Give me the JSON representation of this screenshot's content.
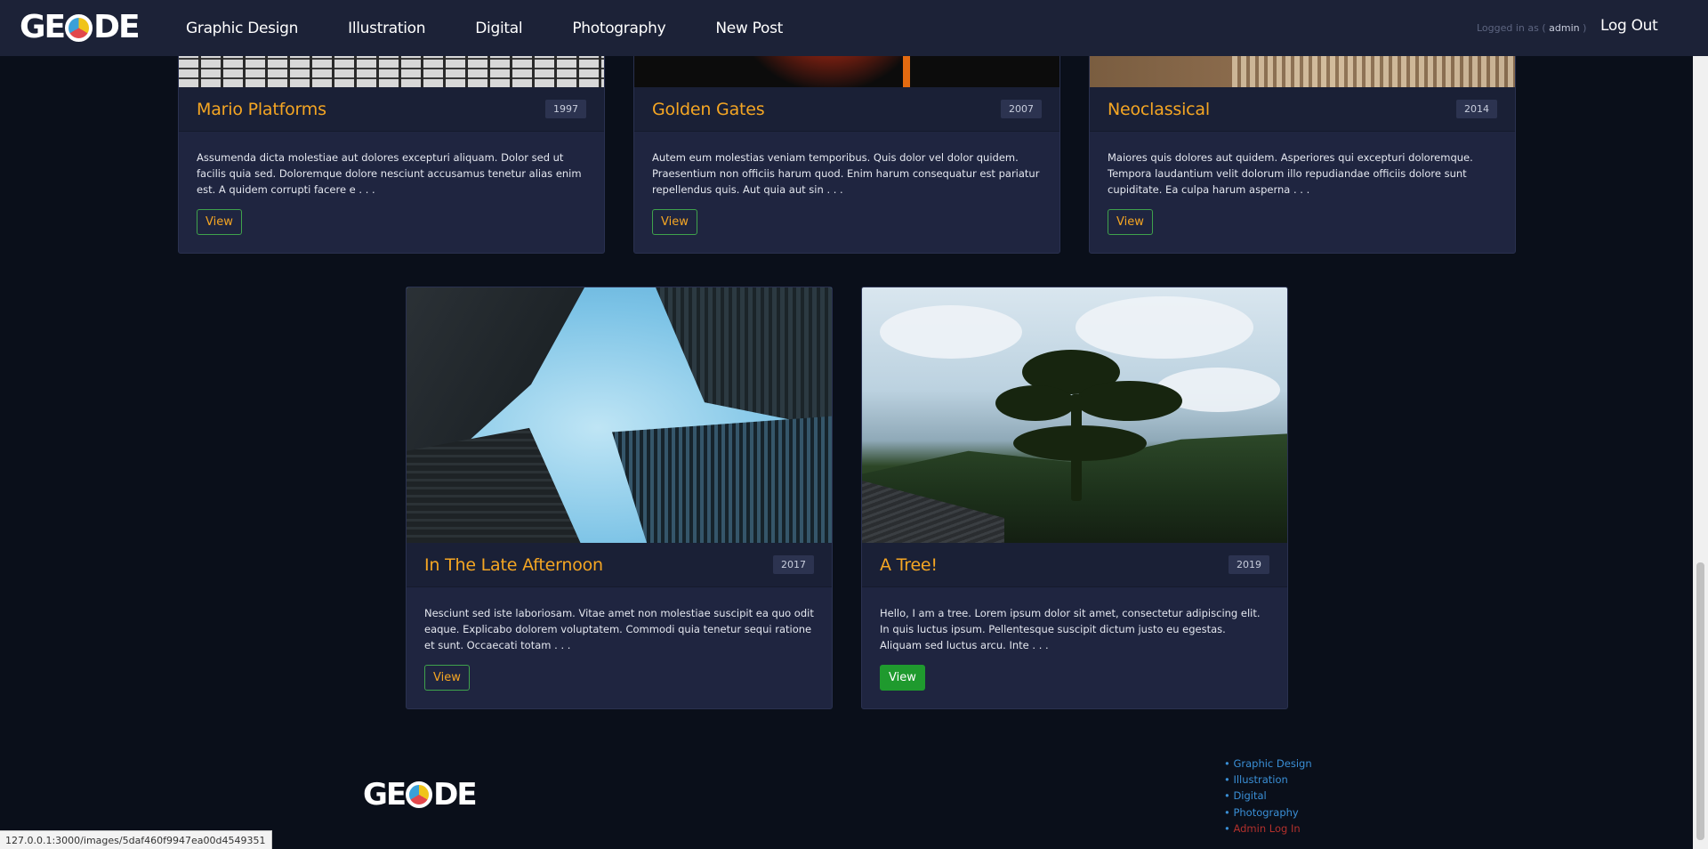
{
  "nav": {
    "logo_prefix": "GE",
    "logo_suffix": "DE",
    "links": [
      "Graphic Design",
      "Illustration",
      "Digital",
      "Photography",
      "New Post"
    ],
    "logged_in_prefix": "Logged in as (",
    "logged_in_user": "admin",
    "logged_in_suffix": ")",
    "logout": "Log Out"
  },
  "cards": [
    {
      "title": "Mario Platforms",
      "year": "1997",
      "description": "Assumenda dicta molestiae aut dolores excepturi aliquam. Dolor sed ut facilis quia sed. Doloremque dolore nesciunt accusamus tenetur alias enim est. A quidem corrupti facere e . . .",
      "button": "View"
    },
    {
      "title": "Golden Gates",
      "year": "2007",
      "description": "Autem eum molestias veniam temporibus. Quis dolor vel dolor quidem. Praesentium non officiis harum quod. Enim harum consequatur est pariatur repellendus quis. Aut quia aut sin . . .",
      "button": "View"
    },
    {
      "title": "Neoclassical",
      "year": "2014",
      "description": "Maiores quis dolores aut quidem. Asperiores qui excepturi doloremque. Tempora laudantium velit dolorum illo repudiandae officiis dolore sunt cupiditate. Ea culpa harum asperna . . .",
      "button": "View"
    },
    {
      "title": "In The Late Afternoon",
      "year": "2017",
      "description": "Nesciunt sed iste laboriosam. Vitae amet non molestiae suscipit ea quo odit eaque. Explicabo dolorem voluptatem. Commodi quia tenetur sequi ratione et sunt. Occaecati totam . . .",
      "button": "View"
    },
    {
      "title": "A Tree!",
      "year": "2019",
      "description": "Hello, I am a tree. Lorem ipsum dolor sit amet, consectetur adipiscing elit. In quis luctus ipsum. Pellentesque suscipit dictum justo eu egestas. Aliquam sed luctus arcu. Inte . . .",
      "button": "View"
    }
  ],
  "footer": {
    "logo_prefix": "GE",
    "logo_suffix": "DE",
    "links": [
      "Graphic Design",
      "Illustration",
      "Digital",
      "Photography"
    ],
    "admin_link": "Admin Log In"
  },
  "status_bar": "127.0.0.1:3000/images/5daf460f9947ea00d4549351",
  "colors": {
    "accent": "#f5a623",
    "background": "#0a0f1a",
    "card": "#1f2540",
    "button_border": "#3fa24c",
    "button_active": "#1f9a2e",
    "link": "#3a8fd6",
    "admin_link": "#b2302c"
  }
}
